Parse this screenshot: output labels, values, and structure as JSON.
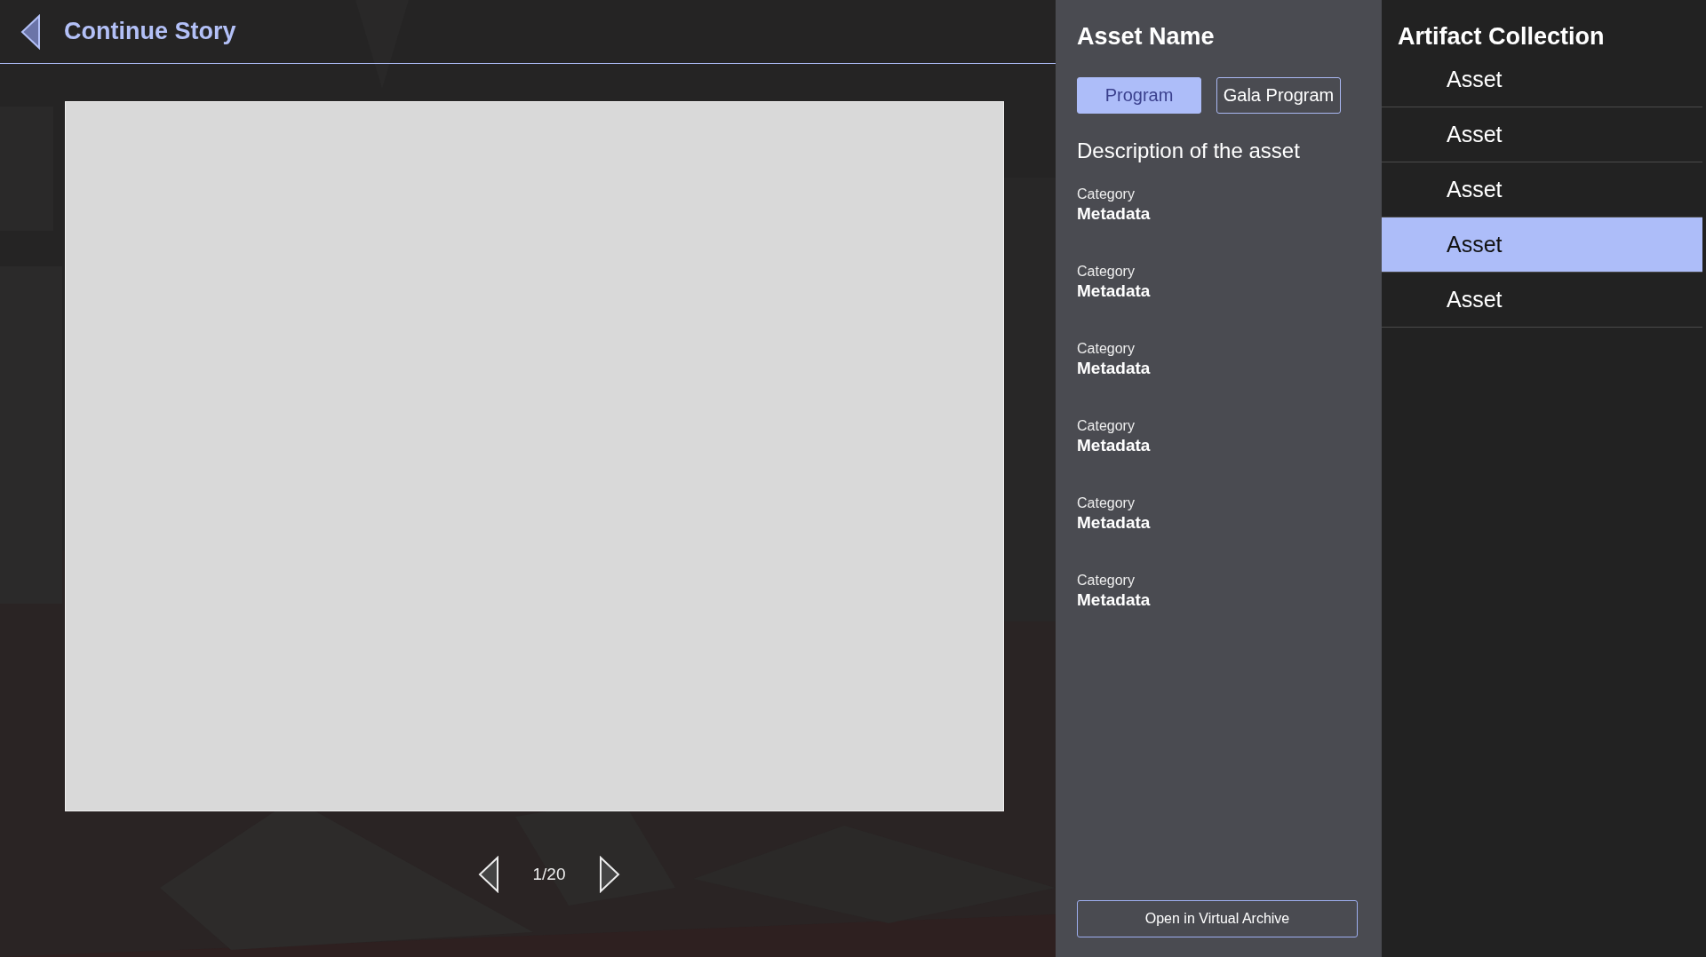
{
  "story": {
    "title": "Continue Story",
    "pager": "1/20"
  },
  "asset": {
    "name": "Asset Name",
    "tabs": [
      {
        "label": "Program",
        "selected": true
      },
      {
        "label": "Gala Program",
        "selected": false
      }
    ],
    "description": "Description of the asset",
    "metadata": [
      {
        "category": "Category",
        "value": "Metadata"
      },
      {
        "category": "Category",
        "value": "Metadata"
      },
      {
        "category": "Category",
        "value": "Metadata"
      },
      {
        "category": "Category",
        "value": "Metadata"
      },
      {
        "category": "Category",
        "value": "Metadata"
      },
      {
        "category": "Category",
        "value": "Metadata"
      }
    ],
    "action": "Open in Virtual Archive"
  },
  "collection": {
    "title": "Artifact Collection",
    "items": [
      {
        "label": "Asset",
        "selected": false
      },
      {
        "label": "Asset",
        "selected": false
      },
      {
        "label": "Asset",
        "selected": false
      },
      {
        "label": "Asset",
        "selected": true
      },
      {
        "label": "Asset",
        "selected": false
      }
    ]
  }
}
